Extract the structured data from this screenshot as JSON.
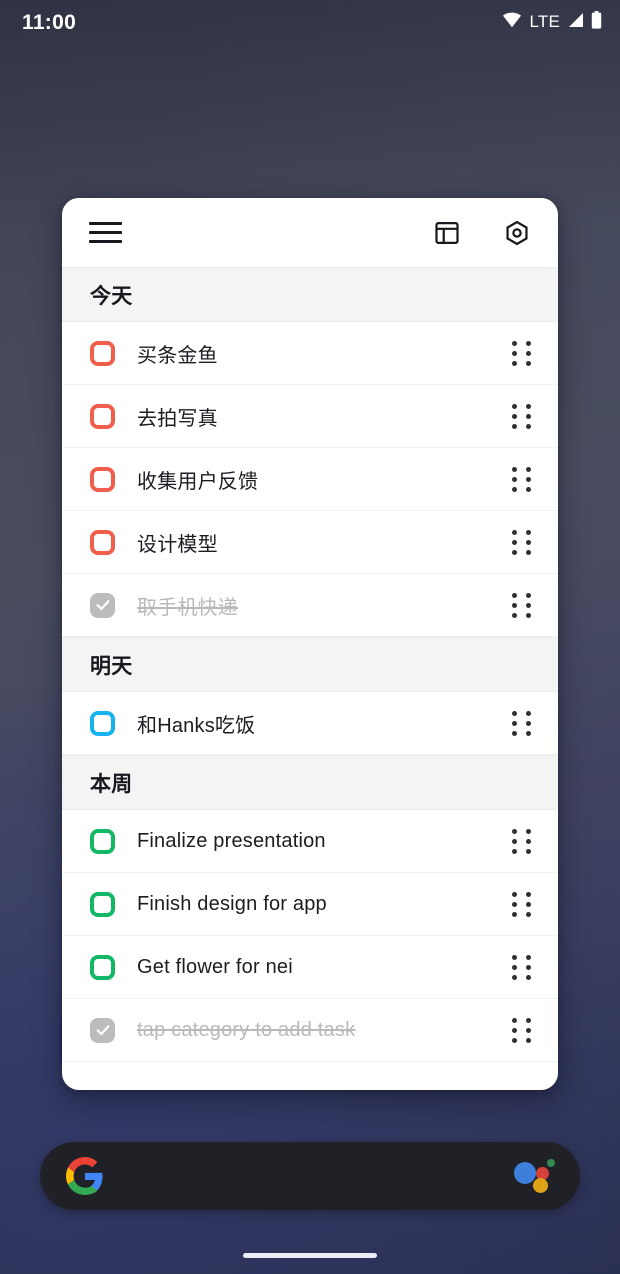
{
  "status_bar": {
    "time": "11:00",
    "network_label": "LTE",
    "icons": [
      "wifi-icon",
      "signal-icon",
      "battery-icon"
    ]
  },
  "app_card": {
    "header": {
      "menu_icon": "hamburger-menu-icon",
      "layout_icon": "layout-board-icon",
      "settings_icon": "hexagon-settings-icon"
    },
    "sections": [
      {
        "title": "今天",
        "accent": "#ef5f4c",
        "tasks": [
          {
            "label": "买条金鱼",
            "done": false
          },
          {
            "label": "去拍写真",
            "done": false
          },
          {
            "label": "收集用户反馈",
            "done": false
          },
          {
            "label": "设计模型",
            "done": false
          },
          {
            "label": "取手机快递",
            "done": true
          }
        ]
      },
      {
        "title": "明天",
        "accent": "#16b3ef",
        "tasks": [
          {
            "label": "和Hanks吃饭",
            "done": false
          }
        ]
      },
      {
        "title": "本周",
        "accent": "#12b865",
        "tasks": [
          {
            "label": "Finalize presentation",
            "done": false
          },
          {
            "label": "Finish design for app",
            "done": false
          },
          {
            "label": "Get flower for nei",
            "done": false
          },
          {
            "label": "tap category to add task",
            "done": true
          }
        ]
      }
    ]
  },
  "google_bar": {
    "logo": "google-g-logo",
    "assistant_icon": "google-assistant-icon"
  },
  "navigation": {
    "gesture_pill": "home-gesture-pill"
  },
  "colors": {
    "today_accent": "#ef5f4c",
    "tomorrow_accent": "#16b3ef",
    "week_accent": "#12b865",
    "completed_gray": "#bcbcbc",
    "card_background": "#ffffff",
    "section_background": "#f4f4f5"
  }
}
